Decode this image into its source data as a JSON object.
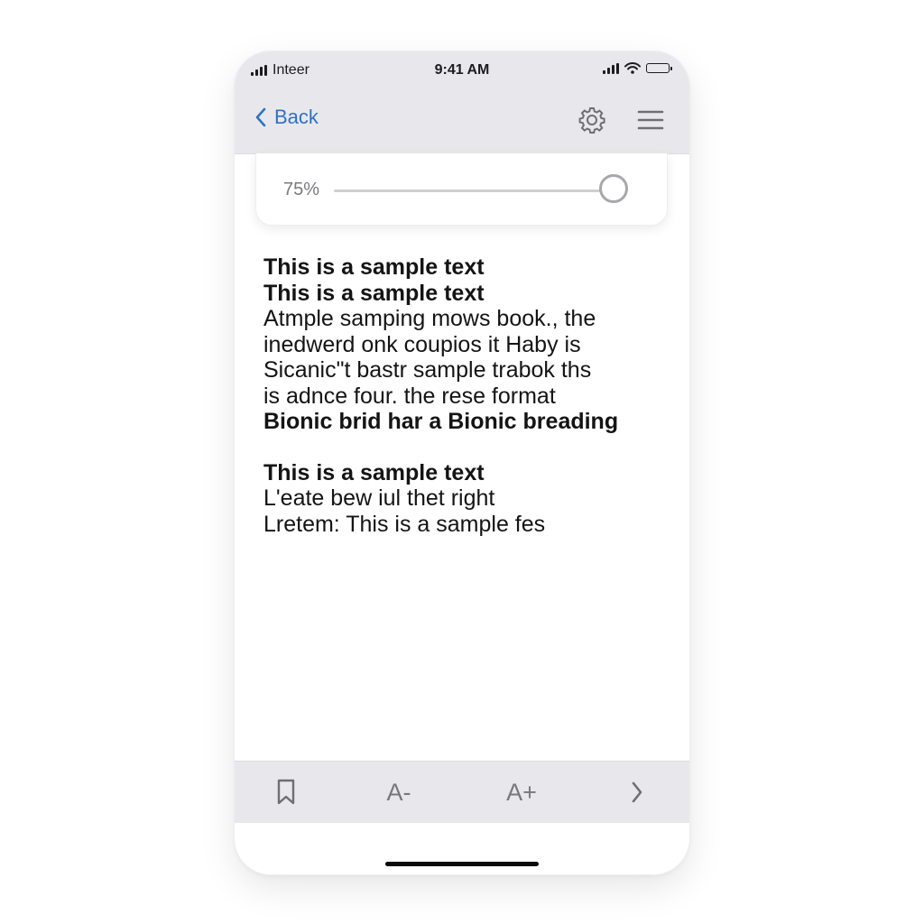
{
  "status_bar": {
    "carrier": "Inteer",
    "time": "9:41 AM"
  },
  "nav": {
    "back_label": "Back",
    "icons": [
      "chevron-left-icon",
      "gear-icon",
      "menu-icon"
    ]
  },
  "zoom": {
    "label": "75%",
    "value_percent": 100
  },
  "content": {
    "lines": [
      {
        "text": "This is a sample text",
        "bold": true
      },
      {
        "text": "This is a sample text",
        "bold": true
      },
      {
        "text": "Atmple samping mows book., the",
        "bold": false
      },
      {
        "text": "inedwerd onk coupios it Haby is",
        "bold": false
      },
      {
        "text": "Sicanic\"t bastr sample trabok ths",
        "bold": false
      },
      {
        "text": "is adnce four. the rese format",
        "bold": false
      },
      {
        "text": "Bionic brid har a Bionic breading",
        "bold": true
      },
      {
        "text": "This is a sample text",
        "bold": true
      },
      {
        "text": "L'eate bew iul thet right",
        "bold": false
      },
      {
        "text": "Lretem: This is a sample fes",
        "bold": false
      }
    ]
  },
  "toolbar": {
    "smaller_label": "A-",
    "larger_label": "A+",
    "icons": [
      "bookmark-icon",
      "chevron-right-icon"
    ]
  },
  "colors": {
    "accent": "#2f72c4",
    "bar_background": "#e8e8ec",
    "toolbar_icon": "#77777c",
    "text": "#141414"
  }
}
